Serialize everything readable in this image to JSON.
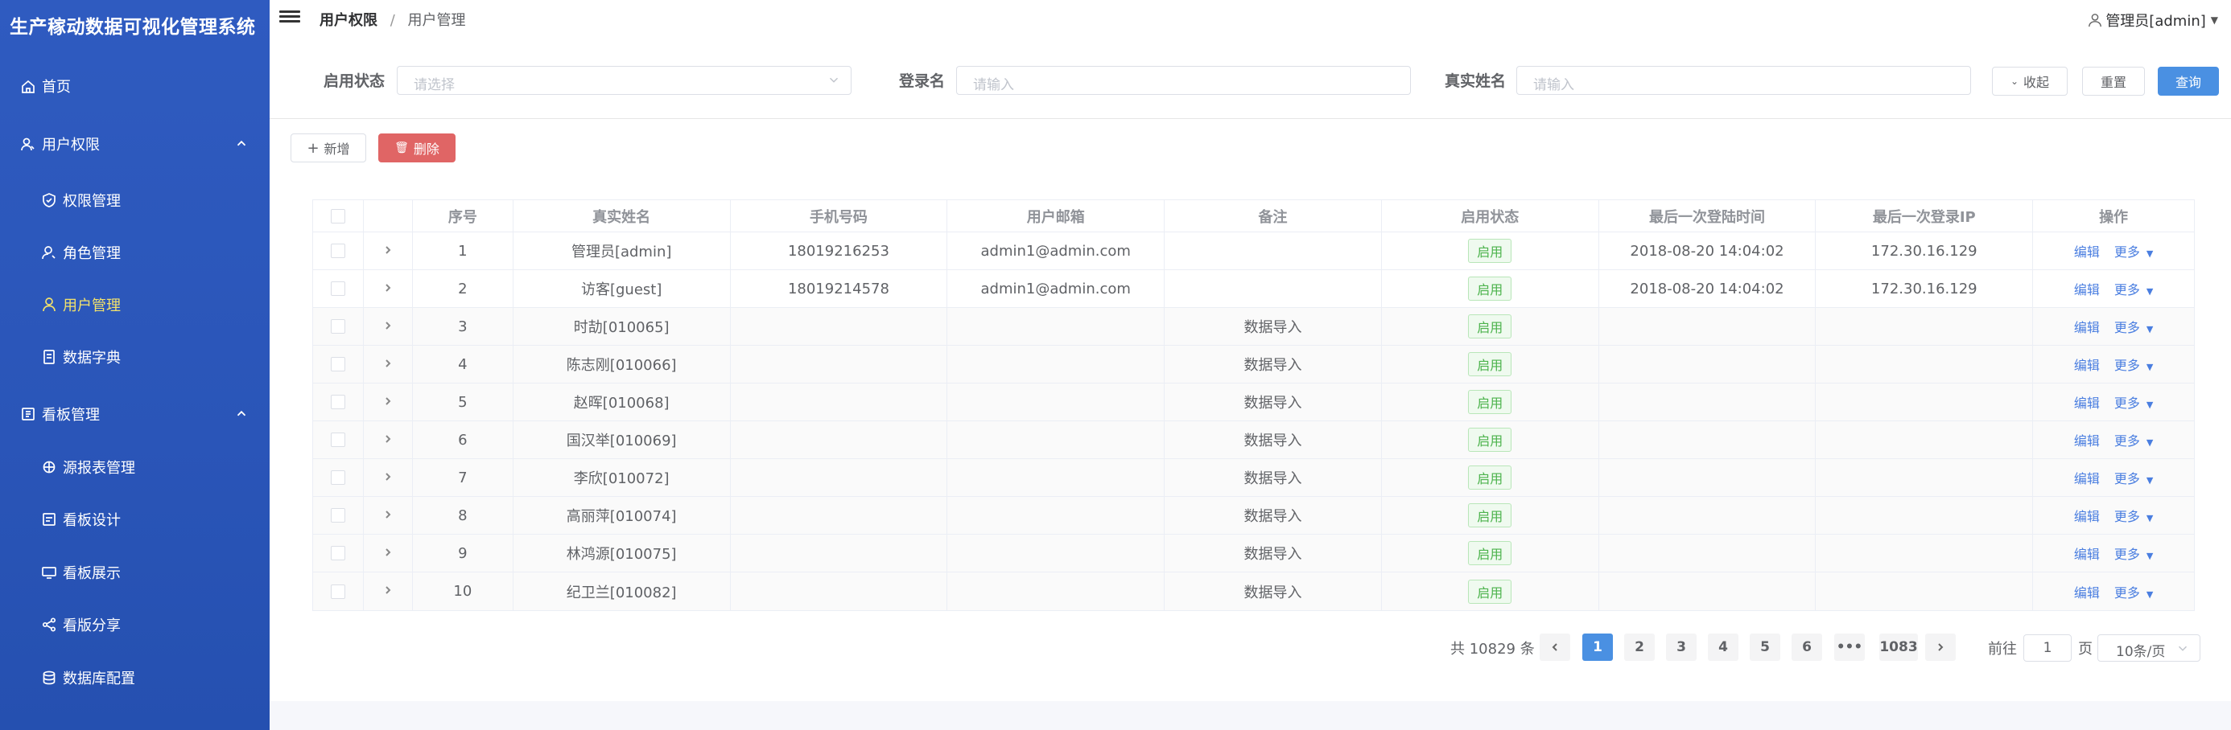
{
  "app": {
    "title": "生产稼动数据可视化管理系统"
  },
  "sidebar": {
    "items": [
      {
        "label": "首页",
        "icon": "home-icon",
        "level": "top"
      },
      {
        "label": "用户权限",
        "icon": "user-group-icon",
        "level": "top",
        "expanded": true
      },
      {
        "label": "权限管理",
        "icon": "shield-icon",
        "level": "sub"
      },
      {
        "label": "角色管理",
        "icon": "role-icon",
        "level": "sub"
      },
      {
        "label": "用户管理",
        "icon": "user-icon",
        "level": "sub",
        "active": true
      },
      {
        "label": "数据字典",
        "icon": "dictionary-icon",
        "level": "sub"
      },
      {
        "label": "看板管理",
        "icon": "dashboard-icon",
        "level": "top",
        "expanded": true
      },
      {
        "label": "源报表管理",
        "icon": "report-source-icon",
        "level": "sub"
      },
      {
        "label": "看板设计",
        "icon": "design-icon",
        "level": "sub"
      },
      {
        "label": "看板展示",
        "icon": "display-icon",
        "level": "sub"
      },
      {
        "label": "看版分享",
        "icon": "share-icon",
        "level": "sub"
      },
      {
        "label": "数据库配置",
        "icon": "database-icon",
        "level": "sub"
      }
    ]
  },
  "header": {
    "breadcrumb": [
      "用户权限",
      "用户管理"
    ],
    "separator": "/",
    "user": "管理员[admin]"
  },
  "filters": {
    "status_label": "启用状态",
    "status_placeholder": "请选择",
    "login_label": "登录名",
    "login_placeholder": "请输入",
    "realname_label": "真实姓名",
    "realname_placeholder": "请输入",
    "collapse_label": "收起",
    "reset_label": "重置",
    "query_label": "查询"
  },
  "toolbar": {
    "add_label": "新增",
    "delete_label": "删除"
  },
  "table": {
    "columns": [
      "序号",
      "真实姓名",
      "手机号码",
      "用户邮箱",
      "备注",
      "启用状态",
      "最后一次登陆时间",
      "最后一次登录IP",
      "操作"
    ],
    "edit_label": "编辑",
    "more_label": "更多",
    "rows": [
      {
        "index": "1",
        "name": "管理员[admin]",
        "phone": "18019216253",
        "email": "admin1@admin.com",
        "remark": "",
        "status": "启用",
        "last_login": "2018-08-20 14:04:02",
        "ip": "172.30.16.129"
      },
      {
        "index": "2",
        "name": "访客[guest]",
        "phone": "18019214578",
        "email": "admin1@admin.com",
        "remark": "",
        "status": "启用",
        "last_login": "2018-08-20 14:04:02",
        "ip": "172.30.16.129"
      },
      {
        "index": "3",
        "name": "时劼[010065]",
        "phone": "",
        "email": "",
        "remark": "数据导入",
        "status": "启用",
        "last_login": "",
        "ip": ""
      },
      {
        "index": "4",
        "name": "陈志刚[010066]",
        "phone": "",
        "email": "",
        "remark": "数据导入",
        "status": "启用",
        "last_login": "",
        "ip": ""
      },
      {
        "index": "5",
        "name": "赵晖[010068]",
        "phone": "",
        "email": "",
        "remark": "数据导入",
        "status": "启用",
        "last_login": "",
        "ip": ""
      },
      {
        "index": "6",
        "name": "国汉举[010069]",
        "phone": "",
        "email": "",
        "remark": "数据导入",
        "status": "启用",
        "last_login": "",
        "ip": ""
      },
      {
        "index": "7",
        "name": "李欣[010072]",
        "phone": "",
        "email": "",
        "remark": "数据导入",
        "status": "启用",
        "last_login": "",
        "ip": ""
      },
      {
        "index": "8",
        "name": "高丽萍[010074]",
        "phone": "",
        "email": "",
        "remark": "数据导入",
        "status": "启用",
        "last_login": "",
        "ip": ""
      },
      {
        "index": "9",
        "name": "林鸿源[010075]",
        "phone": "",
        "email": "",
        "remark": "数据导入",
        "status": "启用",
        "last_login": "",
        "ip": ""
      },
      {
        "index": "10",
        "name": "纪卫兰[010082]",
        "phone": "",
        "email": "",
        "remark": "数据导入",
        "status": "启用",
        "last_login": "",
        "ip": ""
      }
    ]
  },
  "pagination": {
    "total": "共 10829 条",
    "pages": [
      "1",
      "2",
      "3",
      "4",
      "5",
      "6",
      "•••",
      "1083"
    ],
    "current": "1",
    "goto_label": "前往",
    "goto_value": "1",
    "page_unit": "页",
    "page_size": "10条/页"
  },
  "colors": {
    "sidebar": "#2a55b8",
    "active_menu": "#f3e26b",
    "primary": "#4a90e2",
    "danger": "#e06565",
    "tag_green": "#4cb34c"
  }
}
